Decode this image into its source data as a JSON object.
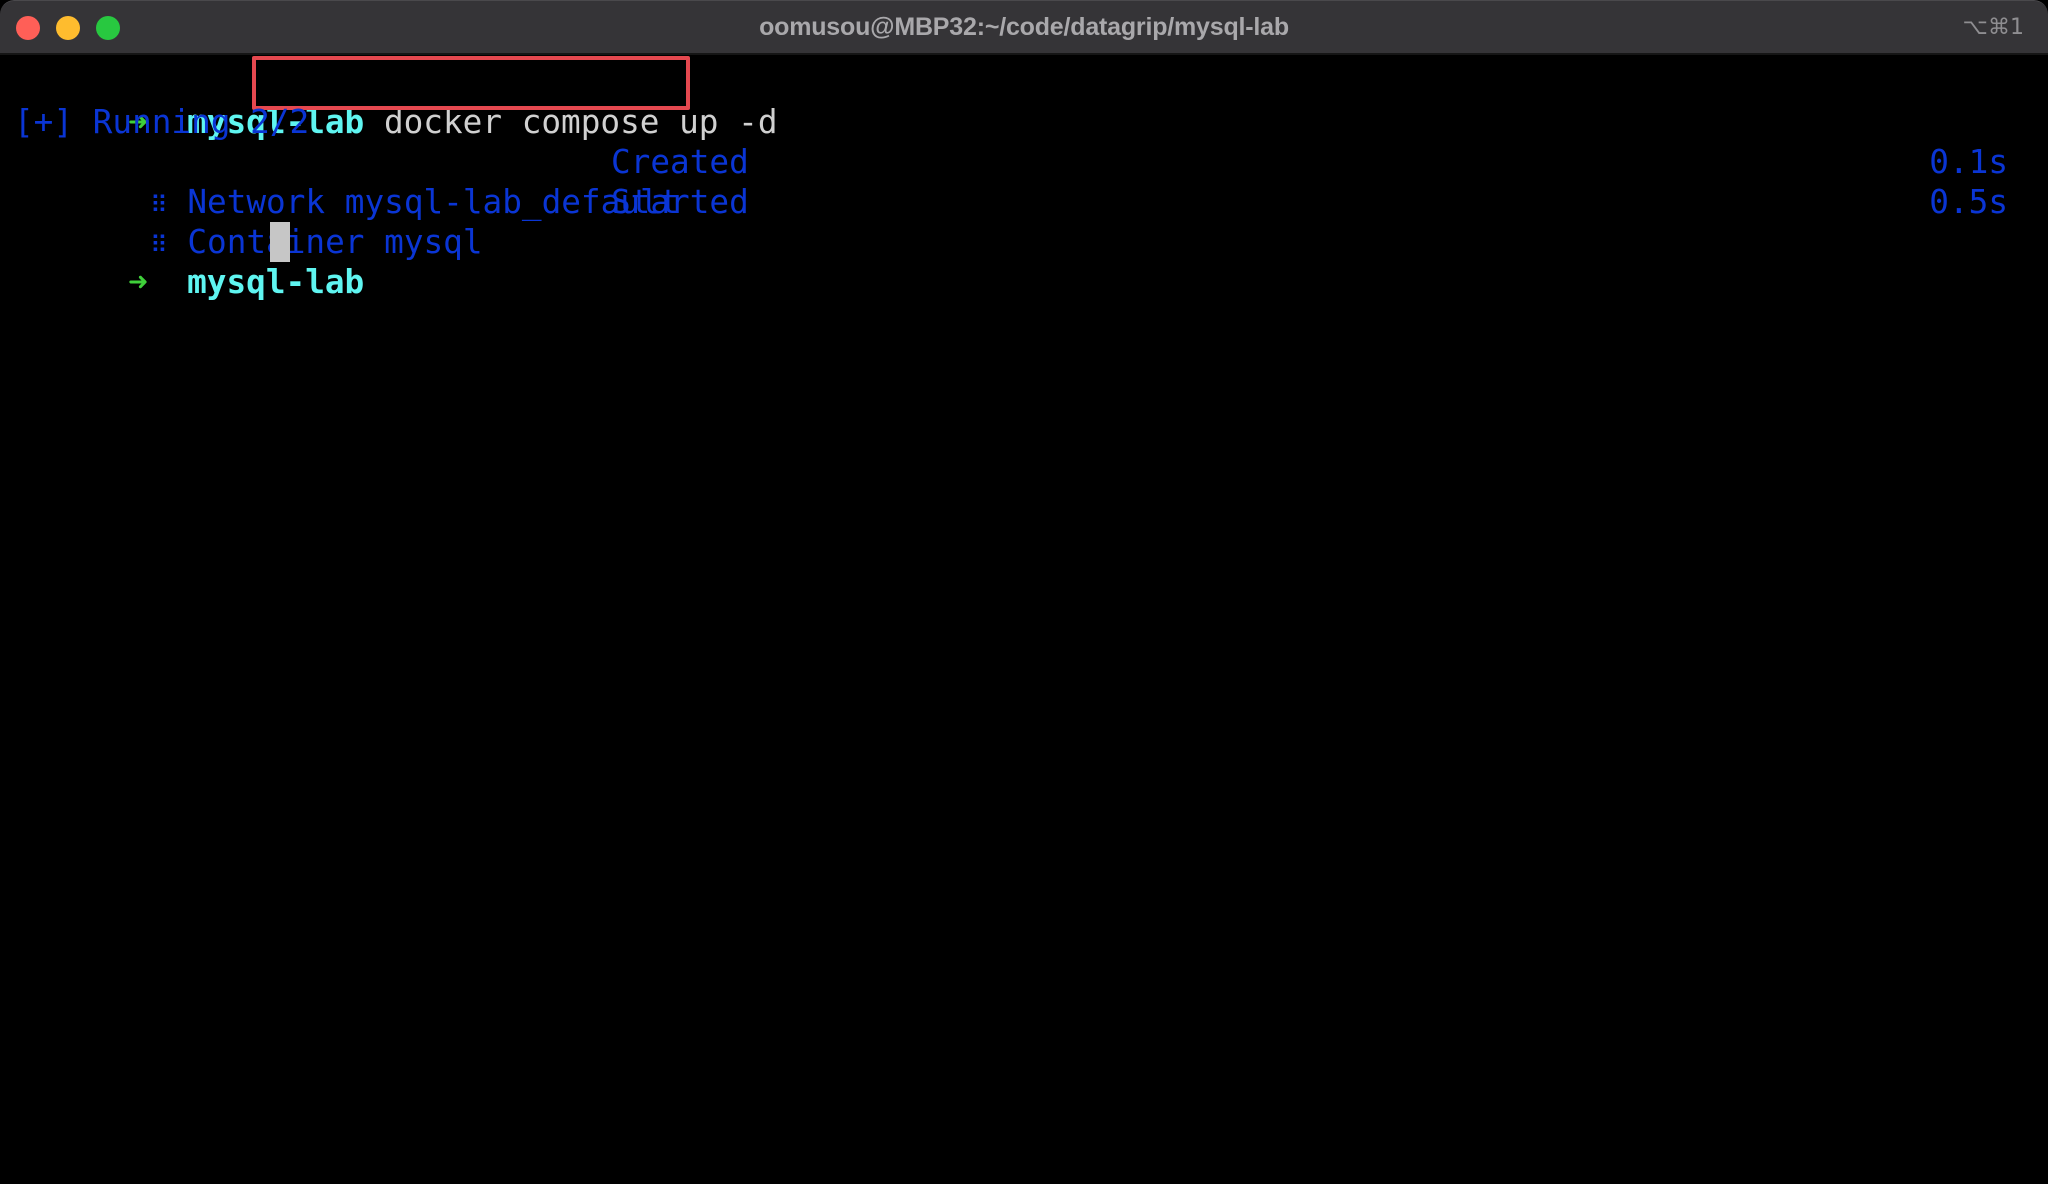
{
  "window": {
    "title": "oomusou@MBP32:~/code/datagrip/mysql-lab",
    "shortcut": "⌥⌘1",
    "traffic_lights": [
      "close",
      "minimize",
      "zoom"
    ]
  },
  "colors": {
    "prompt_arrow": "#3fd03a",
    "prompt_cwd": "#5ff5f1",
    "command": "#d0d0d0",
    "output": "#0a35d4",
    "highlight_box": "#e5484f",
    "cursor": "#c6c6c6",
    "titlebar": "#353437"
  },
  "terminal": {
    "prompt1": {
      "arrow": "➜",
      "cwd": "mysql-lab",
      "command": "docker compose up -d"
    },
    "running": "[+] Running 2/2",
    "tasks": [
      {
        "icon": "⠿",
        "name": "Network mysql-lab_default",
        "status": "Created",
        "time": "0.1s"
      },
      {
        "icon": "⠿",
        "name": "Container mysql",
        "status": "Started",
        "time": "0.5s"
      }
    ],
    "prompt2": {
      "arrow": "➜",
      "cwd": "mysql-lab"
    }
  }
}
